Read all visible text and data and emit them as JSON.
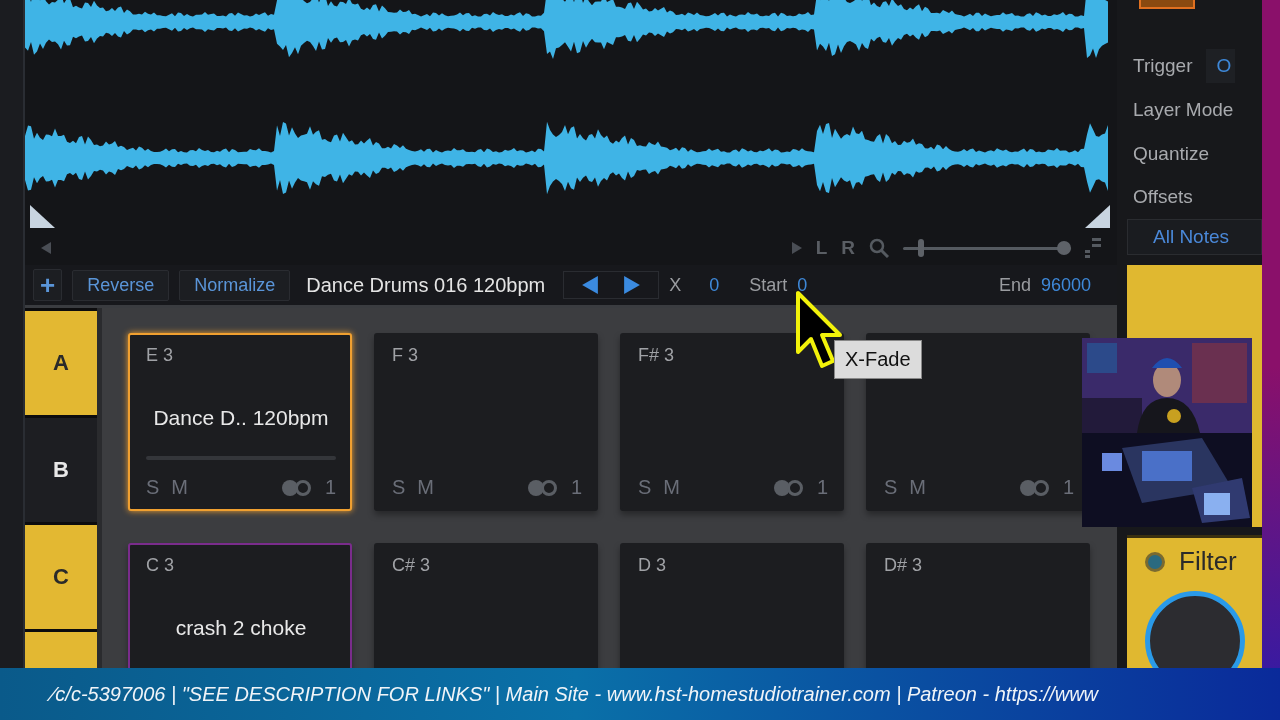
{
  "transport": {
    "left": "L",
    "right": "R",
    "zoom_slider": {
      "level": 0.11
    }
  },
  "toolbar": {
    "add": "+",
    "buttons": [
      "Reverse",
      "Normalize"
    ],
    "sample_name": "Dance Drums 016 120bpm",
    "xfade_label": "X",
    "xfade_value": "0",
    "start_label": "Start",
    "start_value": "0",
    "end_label": "End",
    "end_value": "96000"
  },
  "banks": [
    {
      "label": "A",
      "active": true
    },
    {
      "label": "B",
      "active": false
    },
    {
      "label": "C",
      "active": true
    },
    {
      "active": true
    }
  ],
  "pads": [
    {
      "note": "E 3",
      "sample": "Dance D.. 120bpm",
      "selected": true,
      "solo": "S",
      "mute": "M",
      "count": "1"
    },
    {
      "note": "F 3",
      "selected": false,
      "solo": "S",
      "mute": "M",
      "count": "1"
    },
    {
      "note": "F# 3",
      "selected": false,
      "solo": "S",
      "mute": "M",
      "count": "1"
    },
    {
      "selected": false,
      "solo": "S",
      "mute": "M",
      "count": "1"
    },
    {
      "note": "C 3",
      "sample": "crash 2 choke",
      "selected": false,
      "color": "#7a2c8c"
    },
    {
      "note": "C# 3",
      "selected": false
    },
    {
      "note": "D 3",
      "selected": false
    },
    {
      "note": "D# 3",
      "selected": false
    }
  ],
  "inspector": {
    "rows": [
      {
        "label": "Trigger",
        "value": "O"
      },
      {
        "label": "Layer Mode"
      },
      {
        "label": "Quantize"
      },
      {
        "label": "Offsets"
      }
    ],
    "notes_button": "All Notes",
    "filter": {
      "label": "Filter",
      "on": true
    }
  },
  "tooltip": "X-Fade",
  "ticker": "⁄c/c-5397006 |  \"SEE DESCRIPTION FOR LINKS\" | Main Site - www.hst-homestudiotrainer.com | Patreon - https://www"
}
